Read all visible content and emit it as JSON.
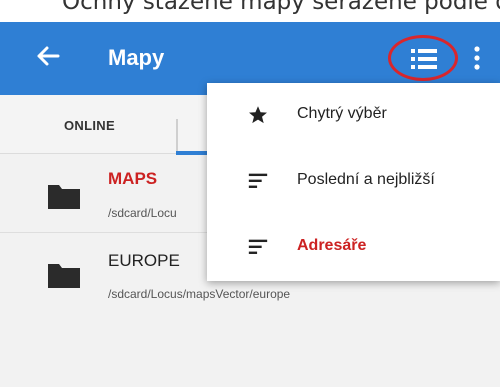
{
  "caption": "Ocnhy stažené mapy seřazené podle d",
  "appbar": {
    "title": "Mapy"
  },
  "tabs": {
    "online": "ONLINE"
  },
  "folders": [
    {
      "name": "MAPS",
      "path": "/sdcard/Locu"
    },
    {
      "name": "EUROPE",
      "path": "/sdcard/Locus/mapsVector/europe"
    }
  ],
  "menu": {
    "items": [
      {
        "label": "Chytrý výběr",
        "icon": "star-icon"
      },
      {
        "label": "Poslední a nejbližší",
        "icon": "sort-lines-icon"
      },
      {
        "label": "Adresáře",
        "icon": "sort-lines-icon"
      }
    ]
  },
  "colors": {
    "appbar": "#2f7fd4",
    "highlight": "#cc2222",
    "circle": "#d9262c"
  }
}
